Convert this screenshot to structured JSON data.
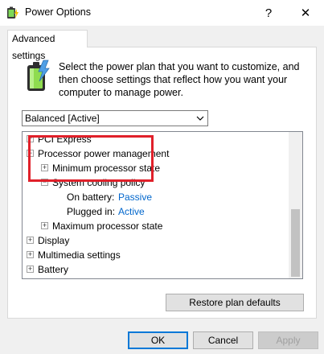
{
  "window": {
    "title": "Power Options",
    "help_glyph": "?",
    "close_glyph": "✕",
    "icon": "power-options-icon"
  },
  "tabs": [
    {
      "label": "Advanced settings",
      "selected": true
    }
  ],
  "description": "Select the power plan that you want to customize, and then choose settings that reflect how you want your computer to manage power.",
  "plan_select": {
    "value": "Balanced [Active]"
  },
  "tree": {
    "items": [
      {
        "label": "PCI Express",
        "expander": "+"
      },
      {
        "label": "Processor power management",
        "expander": "−"
      },
      {
        "label": "Minimum processor state",
        "expander": "+"
      },
      {
        "label": "System cooling policy",
        "expander": "−"
      },
      {
        "label": "On battery:",
        "value": "Passive"
      },
      {
        "label": "Plugged in:",
        "value": "Active"
      },
      {
        "label": "Maximum processor state",
        "expander": "+"
      },
      {
        "label": "Display",
        "expander": "+"
      },
      {
        "label": "Multimedia settings",
        "expander": "+"
      },
      {
        "label": "Battery",
        "expander": "+"
      }
    ]
  },
  "buttons": {
    "restore": "Restore plan defaults",
    "ok": "OK",
    "cancel": "Cancel",
    "apply": "Apply"
  },
  "colors": {
    "highlight": "#e0202a",
    "link": "#0066cc",
    "accent": "#0078d7"
  }
}
